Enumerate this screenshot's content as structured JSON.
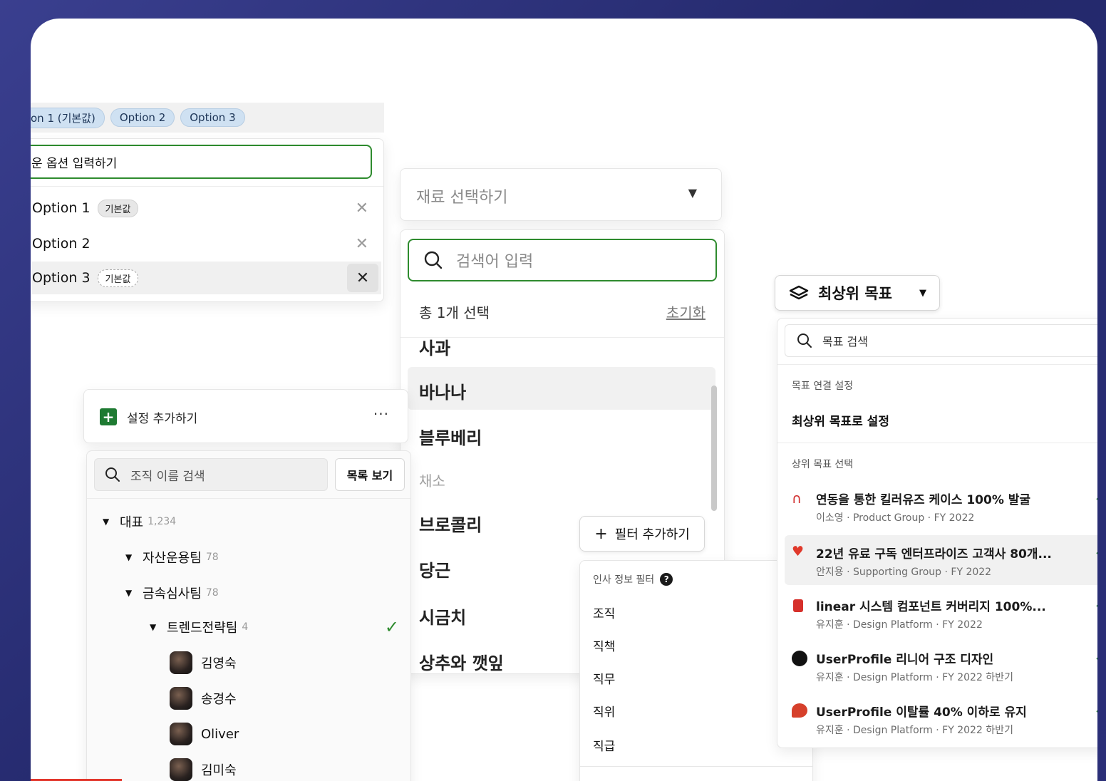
{
  "chips": [
    "on 1 (기본값)",
    "Option 2",
    "Option 3"
  ],
  "option_editor": {
    "input_value": "운 옵션 입력하기",
    "options": [
      {
        "label": "Option 1",
        "tag": "기본값"
      },
      {
        "label": "Option 2",
        "tag": ""
      },
      {
        "label": "Option 3",
        "tag": "기본값"
      }
    ]
  },
  "ingredient": {
    "select_placeholder": "재료 선택하기",
    "search_placeholder": "검색어 입력",
    "summary": "총 1개 선택",
    "reset": "초기화",
    "items": [
      "사과",
      "바나나",
      "블루베리",
      "채소",
      "브로콜리",
      "당근",
      "시금치",
      "상추와 깻잎"
    ]
  },
  "filter": {
    "add_button": "필터 추가하기",
    "section_title": "인사 정보 필터",
    "items": [
      "조직",
      "직책",
      "직무",
      "직위",
      "직급"
    ]
  },
  "org": {
    "add_setting": "설정 추가하기",
    "search_placeholder": "조직 이름 검색",
    "list_button": "목록 보기",
    "tree": [
      {
        "name": "대표",
        "count": "1,234"
      },
      {
        "name": "자산운용팀",
        "count": "78"
      },
      {
        "name": "금속심사팀",
        "count": "78"
      },
      {
        "name": "트렌드전략팀",
        "count": "4"
      }
    ],
    "members": [
      "김영숙",
      "송경수",
      "Oliver",
      "김미숙"
    ]
  },
  "goals": {
    "dropdown_label": "최상위 목표",
    "search_placeholder": "목표 검색",
    "link_section": "목표 연결 설정",
    "set_top": "최상위 목표로 설정",
    "parent_section": "상위 목표 선택",
    "items": [
      {
        "title": "연동을 통한 킬러유즈 케이스 100% 발굴",
        "sub": "이소영 · Product Group · FY 2022"
      },
      {
        "title": "22년 유료 구독 엔터프라이즈 고객사 80개...",
        "sub": "안지용 · Supporting Group · FY 2022"
      },
      {
        "title": "linear 시스템 컴포넌트 커버리지 100%...",
        "sub": "유지훈 · Design Platform · FY 2022"
      },
      {
        "title": "UserProfile 리니어 구조 디자인",
        "sub": "유지훈 · Design Platform · FY 2022 하반기"
      },
      {
        "title": "UserProfile 이탈률 40% 이하로 유지",
        "sub": "유지훈 · Design Platform · FY 2022 하반기"
      }
    ]
  }
}
